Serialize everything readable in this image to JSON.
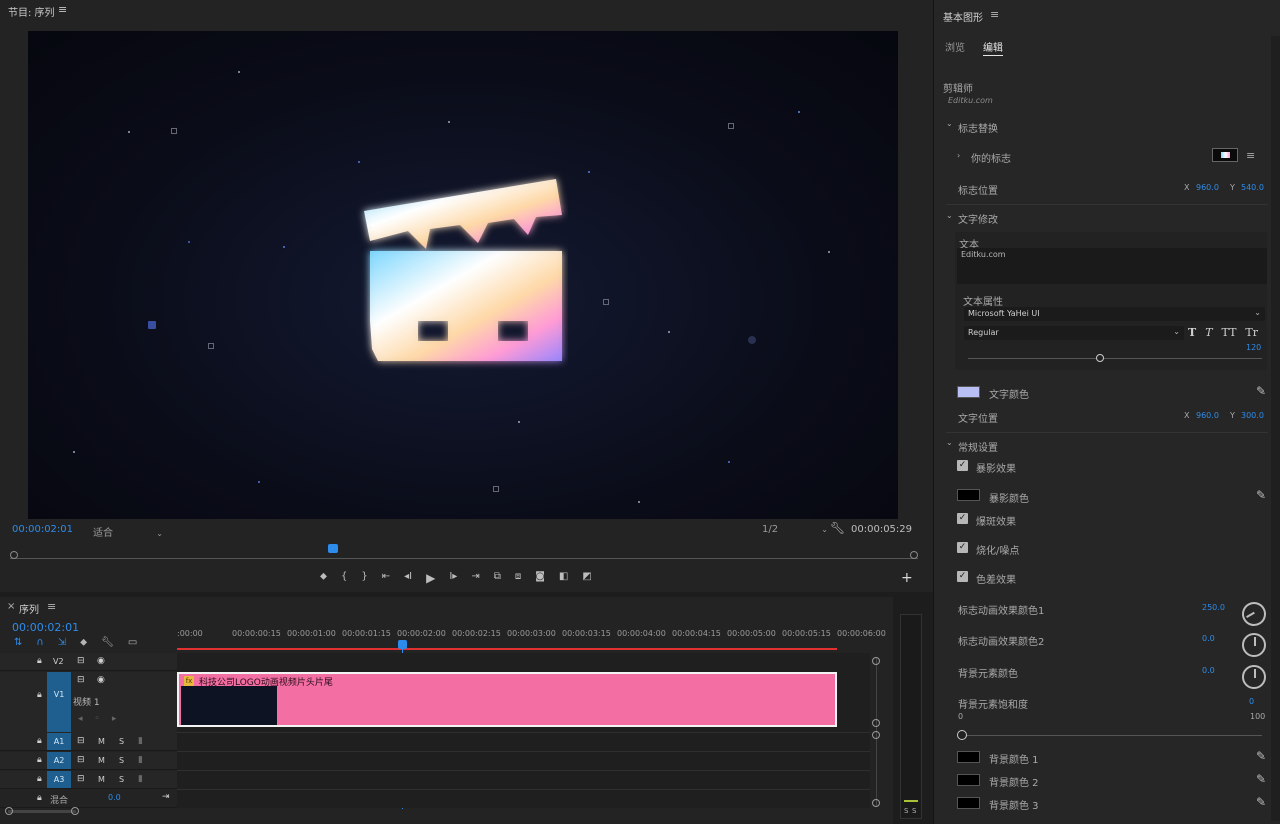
{
  "program": {
    "title": "节目: 序列",
    "menu_icon": "hamburger-icon",
    "timecode_current": "00:00:02:01",
    "fit_label": "适合",
    "resolution": "1/2",
    "timecode_duration": "00:00:05:29",
    "playhead_progress": 0.35,
    "transport_icons": [
      "marker-icon",
      "in-point-icon",
      "out-point-icon",
      "go-to-in-icon",
      "step-back-icon",
      "play-icon",
      "step-forward-icon",
      "go-to-out-icon",
      "lift-icon",
      "extract-icon",
      "export-frame-icon",
      "comparison-icon",
      "multicam-icon"
    ],
    "add_button": "+"
  },
  "sequence": {
    "close": "×",
    "title": "序列",
    "timecode": "00:00:02:01",
    "ruler_ticks": [
      ":00:00",
      "00:00:00:15",
      "00:00:01:00",
      "00:00:01:15",
      "00:00:02:00",
      "00:00:02:15",
      "00:00:03:00",
      "00:00:03:15",
      "00:00:04:00",
      "00:00:04:15",
      "00:00:05:00",
      "00:00:05:15",
      "00:00:06:00"
    ],
    "tracks": {
      "v2": "V2",
      "v1": "V1",
      "v1_name": "视频 1",
      "a1": "A1",
      "a2": "A2",
      "a3": "A3",
      "mix": "混合",
      "mix_value": "0.0",
      "m": "M",
      "s": "S"
    },
    "clip_title": "科技公司LOGO动画视频片头片尾",
    "clip_fx": "fx",
    "meter_labels": [
      "S",
      "S"
    ]
  },
  "essential_graphics": {
    "title": "基本图形",
    "tabs": [
      "浏览",
      "编辑"
    ],
    "active_tab": "编辑",
    "clipboard_label": "剪辑师",
    "clipboard_sub": "Editku.com",
    "section_logo": "标志替换",
    "your_logo": "你的标志",
    "logo_position": "标志位置",
    "logo_x_label": "X",
    "logo_x": "960.0",
    "logo_y_label": "Y",
    "logo_y": "540.0",
    "section_text": "文字修改",
    "text_label": "文本",
    "text_value": "Editku.com",
    "text_props": "文本属性",
    "font": "Microsoft YaHei UI",
    "font_style": "Regular",
    "font_size": "120",
    "font_size_frac": 0.45,
    "style_buttons": [
      "T",
      "T",
      "TT",
      "Tr"
    ],
    "text_color_label": "文字颜色",
    "text_color": "#b9bff2",
    "text_position": "文字位置",
    "text_x_label": "X",
    "text_x": "960.0",
    "text_y_label": "Y",
    "text_y": "300.0",
    "section_general": "常规设置",
    "opt_shadow": "暴影效果",
    "opt_shadow_color": "暴影颜色",
    "opt_flare": "爆斑效果",
    "opt_blur": "烧化/噪点",
    "opt_chroma": "色差效果",
    "logo_anim_color1": "标志动画效果颜色1",
    "logo_anim_color1_val": "250.0",
    "logo_anim_color2": "标志动画效果颜色2",
    "logo_anim_color2_val": "0.0",
    "bg_elem_color": "背景元素颜色",
    "bg_elem_color_val": "0.0",
    "bg_elem_sat": "背景元素饱和度",
    "bg_elem_sat_val": "0",
    "sat_min": "0",
    "sat_max": "100",
    "bg_color1": "背景颜色 1",
    "bg_color2": "背景颜色 2",
    "bg_color3": "背景颜色 3"
  },
  "colors": {
    "accent_blue": "#2d8ceb",
    "clip_pink": "#f36fa3",
    "track_blue": "#1e5f8f",
    "playhead_red": "#e03030"
  }
}
